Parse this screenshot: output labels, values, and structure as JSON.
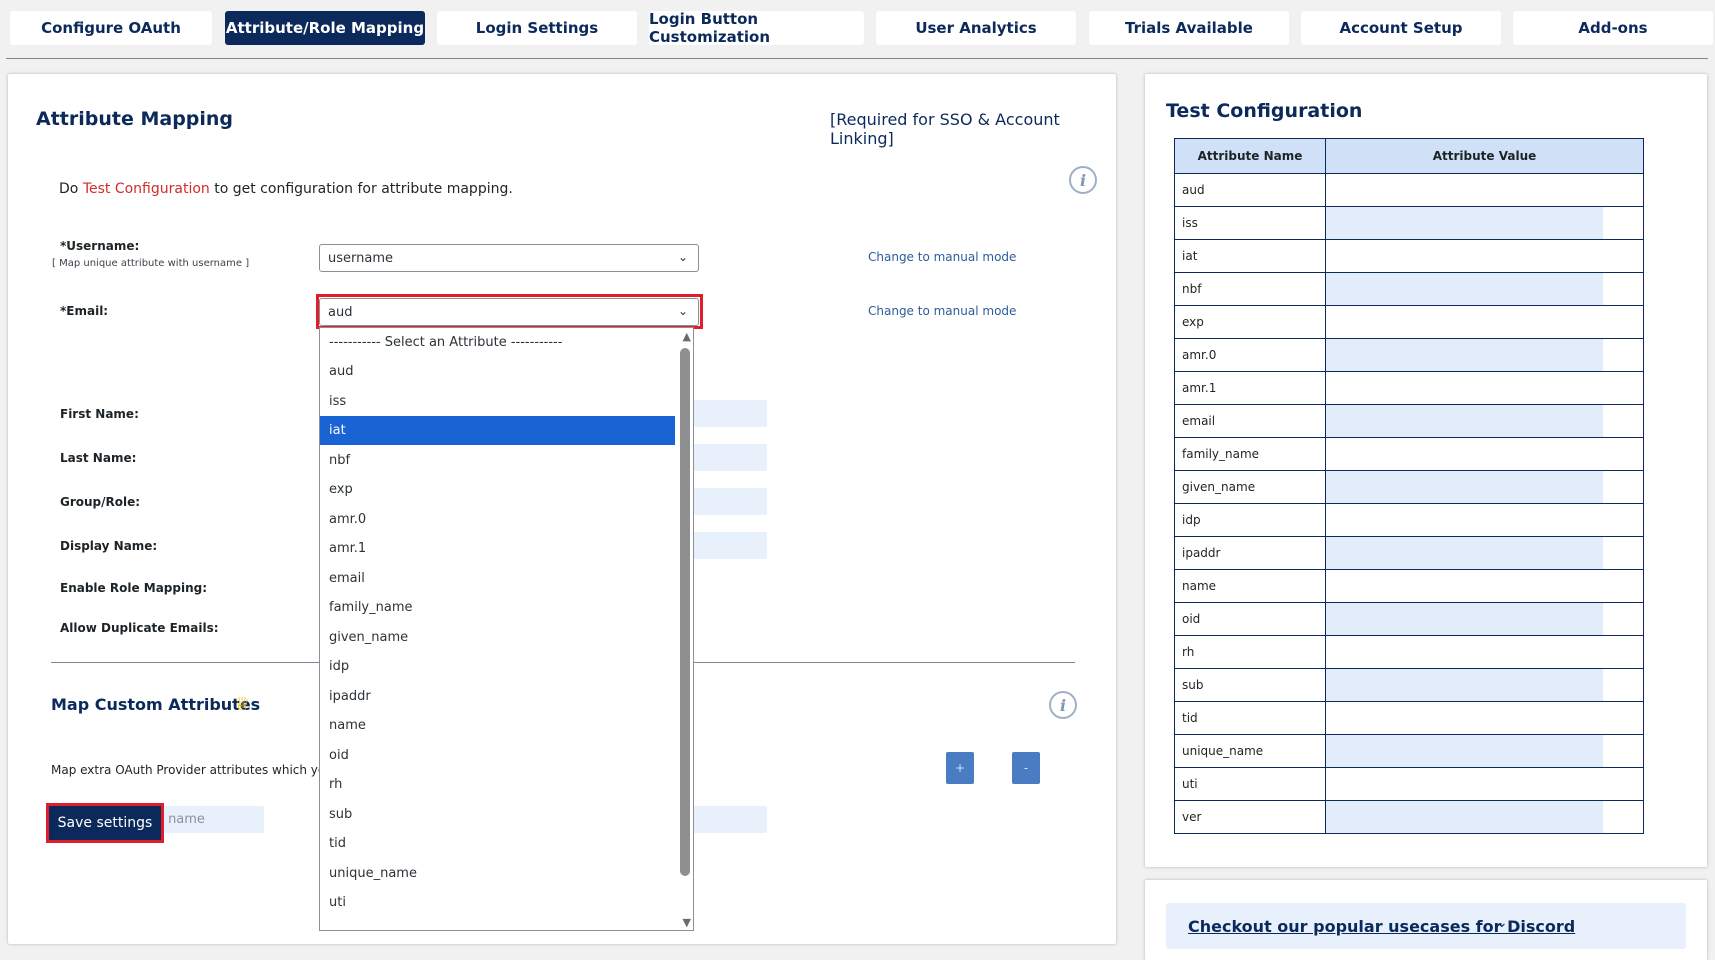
{
  "tabs": [
    {
      "label": "Configure OAuth"
    },
    {
      "label": "Attribute/Role Mapping"
    },
    {
      "label": "Login Settings"
    },
    {
      "label": "Login Button Customization"
    },
    {
      "label": "User Analytics"
    },
    {
      "label": "Trials Available"
    },
    {
      "label": "Account Setup"
    },
    {
      "label": "Add-ons"
    }
  ],
  "attribute_mapping": {
    "title": "Attribute Mapping",
    "required_note": "[Required for SSO & Account Linking]",
    "note_prefix": "Do",
    "note_link": "Test Configuration",
    "note_suffix": "to get configuration for attribute mapping.",
    "username_label": "*Username:",
    "username_sublabel": "[ Map unique attribute with username ]",
    "username_value": "username",
    "email_label": "*Email:",
    "email_value": "aud",
    "manual_mode": "Change to manual mode",
    "first_name_label": "First Name:",
    "last_name_label": "Last Name:",
    "group_role_label": "Group/Role:",
    "display_name_label": "Display Name:",
    "enable_role_label": "Enable Role Mapping:",
    "duplicate_emails_label": "Allow Duplicate Emails:"
  },
  "dropdown": {
    "options": [
      "----------- Select an Attribute -----------",
      "aud",
      "iss",
      "iat",
      "nbf",
      "exp",
      "amr.0",
      "amr.1",
      "email",
      "family_name",
      "given_name",
      "idp",
      "ipaddr",
      "name",
      "oid",
      "rh",
      "sub",
      "tid",
      "unique_name",
      "uti"
    ],
    "highlighted": "iat"
  },
  "custom_attributes": {
    "title": "Map Custom Attributes",
    "description": "Map extra OAuth Provider attributes which you w",
    "meta_placeholder": "Enter field meta name",
    "add_label": "+",
    "remove_label": "-",
    "save_label": "Save settings"
  },
  "test_configuration": {
    "title": "Test Configuration",
    "col_name": "Attribute Name",
    "col_value": "Attribute Value",
    "rows": [
      "aud",
      "iss",
      "iat",
      "nbf",
      "exp",
      "amr.0",
      "amr.1",
      "email",
      "family_name",
      "given_name",
      "idp",
      "ipaddr",
      "name",
      "oid",
      "rh",
      "sub",
      "tid",
      "unique_name",
      "uti",
      "ver"
    ]
  },
  "usecases": {
    "link": "Checkout our popular usecases for Discord"
  },
  "icons": {
    "info": "info-icon",
    "crown": "crown-icon",
    "chevron": "chevron-down-icon"
  },
  "colors": {
    "brand": "#0b2a5b",
    "highlight": "#e01e2b",
    "selected": "#1a63d4",
    "link_red": "#d12c2c"
  }
}
